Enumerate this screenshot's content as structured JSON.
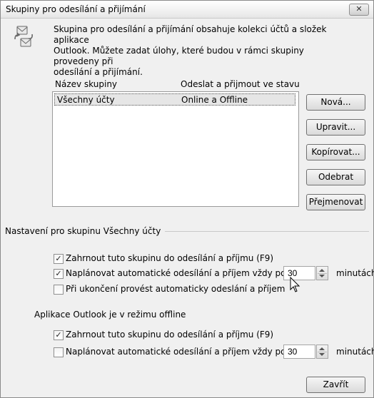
{
  "window": {
    "title": "Skupiny pro odesílání a přijímání",
    "close_label": "✕"
  },
  "intro": {
    "line1": "Skupina pro odesílání a přijímání obsahuje kolekci účtů a složek aplikace",
    "line2": "Outlook. Můžete zadat úlohy, které budou v rámci skupiny provedeny při",
    "line3": "odesílání a přijímání."
  },
  "groups": {
    "headers": [
      "Název skupiny",
      "Odeslat a přijmout ve stavu"
    ],
    "rows": [
      {
        "name": "Všechny účty",
        "state": "Online a Offline"
      }
    ]
  },
  "buttons": {
    "new": "Nová...",
    "edit": "Upravit...",
    "copy": "Kopírovat...",
    "remove": "Odebrat",
    "rename": "Přejmenovat",
    "close": "Zavřít"
  },
  "settings": {
    "section_label": "Nastavení pro skupinu Všechny účty",
    "online": {
      "include_label": "Zahrnout tuto skupinu do odesílání a příjmu (F9)",
      "include_checked": true,
      "schedule_label": "Naplánovat automatické odesílání a příjem vždy po",
      "schedule_checked": true,
      "minutes": "30",
      "minutes_unit": "minutách",
      "on_exit_label": "Při ukončení provést automaticky odeslání a příjem",
      "on_exit_checked": false
    },
    "offline_label": "Aplikace Outlook je v režimu offline",
    "offline": {
      "include_label": "Zahrnout tuto skupinu do odesílání a příjmu (F9)",
      "include_checked": true,
      "schedule_label": "Naplánovat automatické odesílání a příjem vždy po",
      "schedule_checked": false,
      "minutes": "30",
      "minutes_unit": "minutách"
    }
  },
  "icons": {
    "sendreceive": "send-receive-icon",
    "cursor": "mouse-pointer-icon"
  }
}
